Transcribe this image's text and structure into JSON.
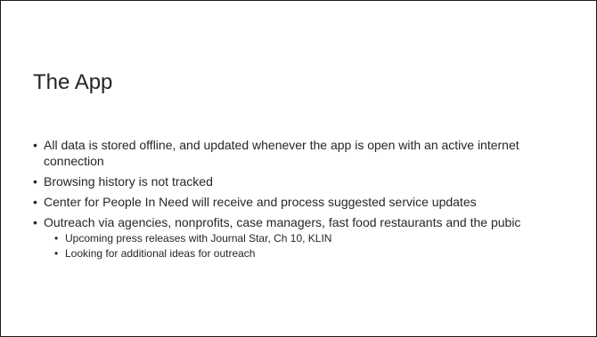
{
  "slide": {
    "title": "The App",
    "bullets": [
      "All data is stored offline, and updated whenever the app is open with an active internet connection",
      "Browsing history is not tracked",
      "Center for People In Need will receive and process suggested service updates",
      "Outreach via agencies, nonprofits, case managers, fast food restaurants and the pubic"
    ],
    "sub_bullets": [
      "Upcoming press releases with Journal Star, Ch 10, KLIN",
      "Looking for additional ideas for outreach"
    ],
    "bullet_glyph": "•"
  }
}
